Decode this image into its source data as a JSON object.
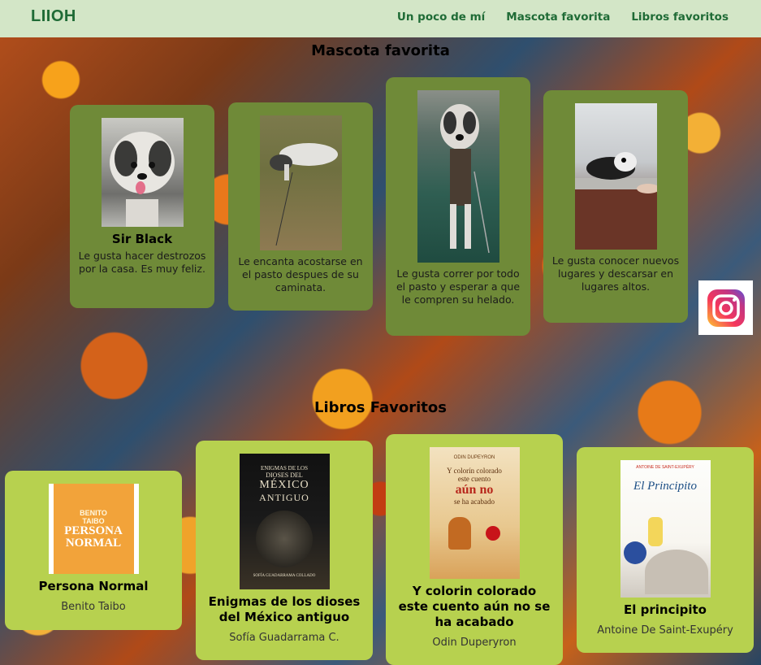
{
  "brand": "LIIOH",
  "nav": {
    "links": [
      "Un poco de mí",
      "Mascota favorita",
      "Libros favoritos"
    ]
  },
  "pets_section": {
    "title": "Mascota favorita",
    "cards": [
      {
        "name": "Sir Black",
        "desc": "Le gusta hacer destrozos por la casa. Es muy feliz."
      },
      {
        "name": "",
        "desc": "Le encanta acostarse en el pasto despues de su caminata."
      },
      {
        "name": "",
        "desc": "Le gusta correr por todo el pasto y esperar a que le compren su helado."
      },
      {
        "name": "",
        "desc": "Le gusta conocer nuevos lugares y descarsar en lugares altos."
      }
    ]
  },
  "books_section": {
    "title": "Libros Favoritos",
    "cards": [
      {
        "title": "Persona Normal",
        "author": "Benito Taibo",
        "cover_text": [
          "BENITO",
          "TAIBO",
          "PERSONA",
          "NORMAL"
        ]
      },
      {
        "title": "Enigmas de los dioses del México antiguo",
        "author": "Sofía Guadarrama C.",
        "cover_text": [
          "ENIGMAS DE LOS",
          "DIOSES DEL",
          "MÉXICO",
          "ANTIGUO",
          "SOFÍA GUADARRAMA COLLADO"
        ]
      },
      {
        "title": "Y colorin colorado este cuento aún no se ha acabado",
        "author": "Odin Duperyron",
        "cover_text": [
          "ODIN DUPEYRON",
          "Y colorín colorado",
          "este cuento",
          "aún no",
          "se ha acabado"
        ]
      },
      {
        "title": "El principito",
        "author": "Antoine De Saint-Exupéry",
        "cover_text": [
          "ANTOINE DE SAINT-EXUPÉRY",
          "El Principito"
        ]
      }
    ]
  },
  "colors": {
    "navbar": "#d3e6c7",
    "brand_text": "#1f6b36",
    "pet_card": "#6f8a38",
    "book_card": "#b7d14f"
  },
  "icons": [
    "instagram-icon"
  ]
}
